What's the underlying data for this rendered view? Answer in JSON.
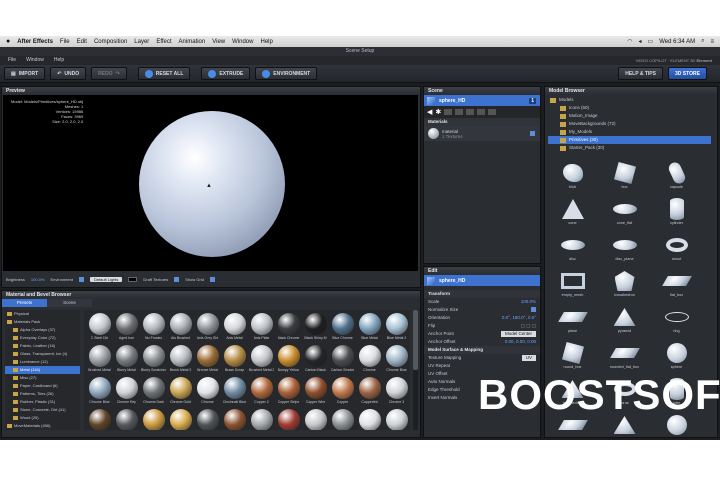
{
  "mac_menu": {
    "apple": "",
    "app_name": "After Effects",
    "items": [
      "File",
      "Edit",
      "Composition",
      "Layer",
      "Effect",
      "Animation",
      "View",
      "Window",
      "Help"
    ],
    "clock": "Wed 6:34 AM"
  },
  "window_title": "Scene Setup",
  "plugin_menu": {
    "items": [
      "File",
      "Window",
      "Help"
    ],
    "info": "VIDEO COPILOT · ELEMENT 3D",
    "element_label": "Element"
  },
  "toolbar": {
    "import": "IMPORT",
    "undo": "UNDO",
    "redo": "REDO",
    "reset_all": "RESET ALL",
    "extrude": "EXTRUDE",
    "environment": "ENVIRONMENT",
    "help_tips": "HELP & TIPS",
    "store": "3D STORE",
    "close": "X",
    "ok": "OK"
  },
  "preview": {
    "title": "Preview",
    "info": [
      "Model: Models/Primitives/sphere_HD.obj",
      "Meshes: 1",
      "Vertices: 15986",
      "Faces: 3969",
      "Size: 2.0, 2.0, 2.0"
    ],
    "brightness_label": "Brightness",
    "brightness_value": "100.0%",
    "environment_label": "Environment",
    "lights_value": "Default Lights",
    "draft_textures": "Draft Textures",
    "show_grid": "Show Grid"
  },
  "material_browser": {
    "title": "Material and Bevel Browser",
    "tabs": [
      "Presets",
      "Scene"
    ],
    "tree": [
      "Physical",
      "Materials Pack",
      "Alpha Overlays (37)",
      "Everyday Color (72)",
      "Fabric, Leather (16)",
      "Glass, Transparent, Ice (4)",
      "Luminance (12)",
      "Metal (116)",
      "Misc (27)",
      "Paper, Cardboard (6)",
      "Patterns, Tiles (26)",
      "Rubber, Plastic (31)",
      "Stone, Concrete, Dirt (41)",
      "Wood (25)",
      "MoveMaterials (456)",
      "Pro_Shaders"
    ],
    "selected_tree": "Metal (116)",
    "materials": [
      {
        "name": "C Steel Dbl",
        "color": "#c2c8cf"
      },
      {
        "name": "Aged Iron",
        "color": "#6b6e72"
      },
      {
        "name": "Alu Frosted",
        "color": "#b3b8bd"
      },
      {
        "name": "Alu Brushed",
        "color": "#a9adb2"
      },
      {
        "name": "Anis Grey Sht",
        "color": "#8e9398"
      },
      {
        "name": "Anis Metal",
        "color": "#d4d6d9"
      },
      {
        "name": "Anis Plate",
        "color": "#bdc1c6"
      },
      {
        "name": "Black Chrome",
        "color": "#3a3c3f"
      },
      {
        "name": "Black Shiny M",
        "color": "#1e1f21"
      },
      {
        "name": "Blue Chrome",
        "color": "#4f6f8c"
      },
      {
        "name": "Blue Metal",
        "color": "#7fa3bd"
      },
      {
        "name": "Blue Metal 2",
        "color": "#a4c0d2"
      },
      {
        "name": "Brushed Metal",
        "color": "#9b9fa4"
      },
      {
        "name": "Blurry Metal",
        "color": "#767a7f"
      },
      {
        "name": "Blurry Scratched",
        "color": "#8a8e92"
      },
      {
        "name": "Brush Metal 3",
        "color": "#b8bcc1"
      },
      {
        "name": "Bronze Metal",
        "color": "#9a6a35"
      },
      {
        "name": "Brass Scrap",
        "color": "#b58a44"
      },
      {
        "name": "Brushed Metal 2",
        "color": "#c3c6ca"
      },
      {
        "name": "Bumpy Yellow",
        "color": "#c98b2c"
      },
      {
        "name": "Carbon Black",
        "color": "#242527"
      },
      {
        "name": "Carbon Smoke",
        "color": "#4b4d50"
      },
      {
        "name": "Chrome",
        "color": "#d9dbde"
      },
      {
        "name": "Chrome Blue",
        "color": "#9fb4c7"
      },
      {
        "name": "Chrome Blue",
        "color": "#8ea6bc"
      },
      {
        "name": "Chrome Rep",
        "color": "#cfd2d6"
      },
      {
        "name": "Chrome Dark",
        "color": "#6e7175"
      },
      {
        "name": "Chrome Gold",
        "color": "#c9a352"
      },
      {
        "name": "Chrome",
        "color": "#e1e3e5"
      },
      {
        "name": "Cincinnati Blue",
        "color": "#7189a3"
      },
      {
        "name": "Copper 2",
        "color": "#b0673b"
      },
      {
        "name": "Copper Stripe",
        "color": "#a85f36"
      },
      {
        "name": "Copper Wire",
        "color": "#8d4e2c"
      },
      {
        "name": "Copper",
        "color": "#c0784a"
      },
      {
        "name": "Coppertint",
        "color": "#9b6244"
      },
      {
        "name": "Chrome 3",
        "color": "#d0d3d7"
      },
      {
        "name": "Dark Bronze",
        "color": "#5e4428"
      },
      {
        "name": "Dark Steel",
        "color": "#55585c"
      },
      {
        "name": "Gold Blur",
        "color": "#c9993f"
      },
      {
        "name": "Gold Shiny",
        "color": "#d8ab4e"
      },
      {
        "name": "Gun Metal",
        "color": "#505357"
      },
      {
        "name": "Iron Rust",
        "color": "#8a5230"
      },
      {
        "name": "Metal Plate",
        "color": "#a5a9ad"
      },
      {
        "name": "Metallic Red",
        "color": "#9e3b32"
      },
      {
        "name": "Nickel",
        "color": "#c5c7c9"
      },
      {
        "name": "Pewter",
        "color": "#8c8f92"
      },
      {
        "name": "Platinum",
        "color": "#dfe1e3"
      },
      {
        "name": "Silver",
        "color": "#cdd0d3"
      }
    ]
  },
  "scene": {
    "title": "Scene",
    "object": "sphere_HD",
    "group_badge": "1",
    "materials_label": "Materials",
    "material_name": "material",
    "material_sub": "1 Textures"
  },
  "edit": {
    "title": "Edit",
    "object": "sphere_HD",
    "transform_label": "Transform",
    "scale_label": "Scale",
    "scale_value": "100.0%",
    "normalize_label": "Normalize Size",
    "orientation_label": "Orientation",
    "orientation_value": "0.0°, 180.0°, 0.0°",
    "flip_label": "Flip",
    "anchor_point_label": "Anchor Point",
    "anchor_point_value": "Model Center",
    "anchor_offset_label": "Anchor Offset",
    "anchor_offset_value": "0.00, 0.00, 0.00",
    "surface_label": "Model Surface & Mapping",
    "texture_mapping_label": "Texture Mapping",
    "texture_mapping_value": "UV",
    "uv_repeat_label": "UV Repeat",
    "uv_offset_label": "UV Offset",
    "auto_normals_label": "Auto Normals",
    "edge_threshold_label": "Edge Threshold",
    "invert_normals_label": "Invert Normals"
  },
  "model_browser": {
    "title": "Model Browser",
    "tree": [
      "Models",
      "Icons (50)",
      "Motion_Image",
      "MoveBackgrounds (72)",
      "My_Models",
      "Primitives (30)",
      "Starter_Pack (30)"
    ],
    "selected_tree": "Primitives (30)",
    "models": [
      {
        "name": "blob",
        "shape": "blob"
      },
      {
        "name": "box",
        "shape": "box"
      },
      {
        "name": "capsule",
        "shape": "capsule"
      },
      {
        "name": "cone",
        "shape": "cone"
      },
      {
        "name": "cone_flat",
        "shape": "disc"
      },
      {
        "name": "cylinder",
        "shape": "cylinder"
      },
      {
        "name": "disc",
        "shape": "disc"
      },
      {
        "name": "disc_plane",
        "shape": "disc"
      },
      {
        "name": "donut",
        "shape": "torus"
      },
      {
        "name": "empty_mesh",
        "shape": "frame"
      },
      {
        "name": "icosahedron",
        "shape": "ico"
      },
      {
        "name": "flat_box",
        "shape": "plane"
      },
      {
        "name": "plane",
        "shape": "plane"
      },
      {
        "name": "pyramid",
        "shape": "pyramid"
      },
      {
        "name": "ring",
        "shape": "ring"
      },
      {
        "name": "round_box",
        "shape": "box"
      },
      {
        "name": "rounded_flat_box",
        "shape": "plane"
      },
      {
        "name": "sphere",
        "shape": "sphere"
      },
      {
        "name": "tetrahedron",
        "shape": "pyramid"
      },
      {
        "name": "torus",
        "shape": "torus"
      },
      {
        "name": "tube",
        "shape": "cylinder"
      },
      {
        "name": "tile_box_rounded",
        "shape": "plane"
      },
      {
        "name": "triangle",
        "shape": "pyramid"
      },
      {
        "name": "triangle_ball",
        "shape": "sphere"
      }
    ]
  },
  "watermark": "BOOSTSOFT"
}
